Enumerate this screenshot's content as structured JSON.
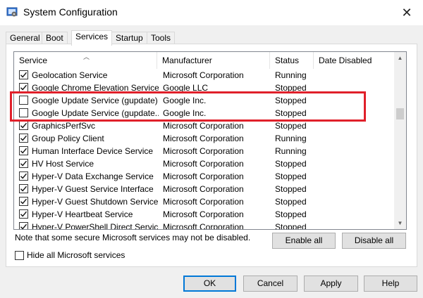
{
  "window": {
    "title": "System Configuration",
    "close_icon": "close-icon"
  },
  "tabs": [
    {
      "label": "General"
    },
    {
      "label": "Boot"
    },
    {
      "label": "Services",
      "active": true
    },
    {
      "label": "Startup"
    },
    {
      "label": "Tools"
    }
  ],
  "table": {
    "columns": [
      "Service",
      "Manufacturer",
      "Status",
      "Date Disabled"
    ],
    "rows": [
      {
        "checked": true,
        "service": "Geolocation Service",
        "manufacturer": "Microsoft Corporation",
        "status": "Running",
        "date": ""
      },
      {
        "checked": true,
        "service": "Google Chrome Elevation Service",
        "manufacturer": "Google LLC",
        "status": "Stopped",
        "date": ""
      },
      {
        "checked": false,
        "service": "Google Update Service (gupdate)",
        "manufacturer": "Google Inc.",
        "status": "Stopped",
        "date": ""
      },
      {
        "checked": false,
        "service": "Google Update Service (gupdate...",
        "manufacturer": "Google Inc.",
        "status": "Stopped",
        "date": ""
      },
      {
        "checked": true,
        "service": "GraphicsPerfSvc",
        "manufacturer": "Microsoft Corporation",
        "status": "Stopped",
        "date": ""
      },
      {
        "checked": true,
        "service": "Group Policy Client",
        "manufacturer": "Microsoft Corporation",
        "status": "Running",
        "date": ""
      },
      {
        "checked": true,
        "service": "Human Interface Device Service",
        "manufacturer": "Microsoft Corporation",
        "status": "Running",
        "date": ""
      },
      {
        "checked": true,
        "service": "HV Host Service",
        "manufacturer": "Microsoft Corporation",
        "status": "Stopped",
        "date": ""
      },
      {
        "checked": true,
        "service": "Hyper-V Data Exchange Service",
        "manufacturer": "Microsoft Corporation",
        "status": "Stopped",
        "date": ""
      },
      {
        "checked": true,
        "service": "Hyper-V Guest Service Interface",
        "manufacturer": "Microsoft Corporation",
        "status": "Stopped",
        "date": ""
      },
      {
        "checked": true,
        "service": "Hyper-V Guest Shutdown Service",
        "manufacturer": "Microsoft Corporation",
        "status": "Stopped",
        "date": ""
      },
      {
        "checked": true,
        "service": "Hyper-V Heartbeat Service",
        "manufacturer": "Microsoft Corporation",
        "status": "Stopped",
        "date": ""
      },
      {
        "checked": true,
        "service": "Hyper-V PowerShell Direct Service",
        "manufacturer": "Microsoft Corporation",
        "status": "Stopped",
        "date": ""
      }
    ]
  },
  "note": "Note that some secure Microsoft services may not be disabled.",
  "buttons": {
    "enable_all": "Enable all",
    "disable_all": "Disable all",
    "ok": "OK",
    "cancel": "Cancel",
    "apply": "Apply",
    "help": "Help"
  },
  "hide_ms": {
    "label": "Hide all Microsoft services",
    "checked": false
  },
  "colors": {
    "highlight": "#e0202a",
    "accent": "#0078d7"
  }
}
